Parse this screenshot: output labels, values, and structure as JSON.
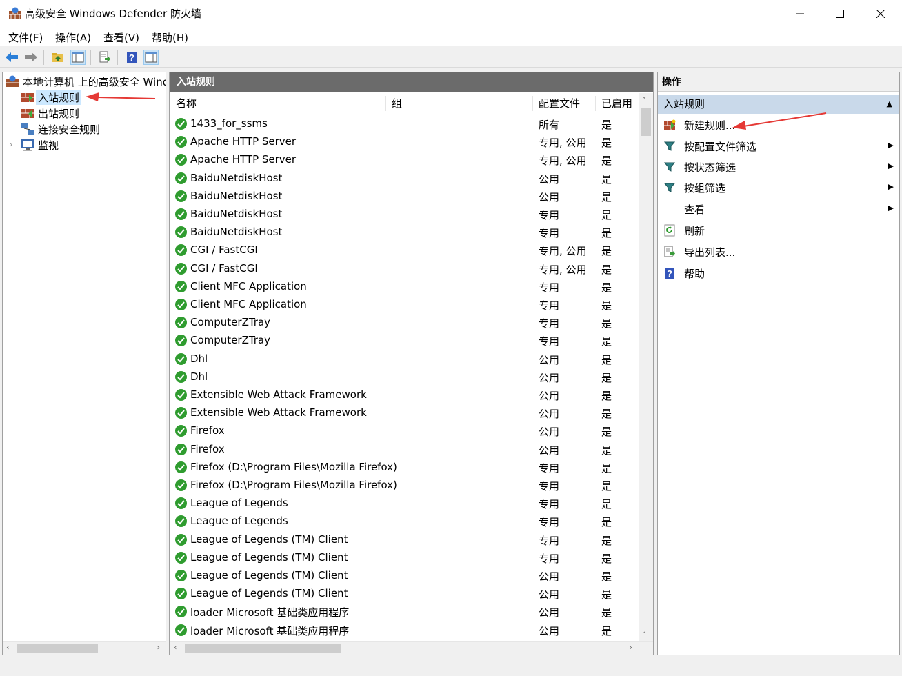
{
  "window": {
    "title": "高级安全 Windows Defender 防火墙",
    "controls": [
      "minimize",
      "maximize",
      "close"
    ]
  },
  "menu": [
    "文件(F)",
    "操作(A)",
    "查看(V)",
    "帮助(H)"
  ],
  "toolbar": [
    "back-icon",
    "forward-icon",
    "up-folder-icon",
    "show-tree-icon",
    "export-icon",
    "help-icon",
    "show-action-pane-icon"
  ],
  "tree": {
    "root": "本地计算机 上的高级安全 Windows Defender 防火墙",
    "items": [
      {
        "label": "入站规则",
        "selected": true
      },
      {
        "label": "出站规则"
      },
      {
        "label": "连接安全规则"
      },
      {
        "label": "监视",
        "expandable": true
      }
    ]
  },
  "middle": {
    "header": "入站规则",
    "columns": [
      "名称",
      "组",
      "配置文件",
      "已启用"
    ],
    "rows": [
      {
        "name": "1433_for_ssms",
        "group": "",
        "profile": "所有",
        "enabled": "是"
      },
      {
        "name": "Apache HTTP Server",
        "group": "",
        "profile": "专用, 公用",
        "enabled": "是"
      },
      {
        "name": "Apache HTTP Server",
        "group": "",
        "profile": "专用, 公用",
        "enabled": "是"
      },
      {
        "name": "BaiduNetdiskHost",
        "group": "",
        "profile": "公用",
        "enabled": "是"
      },
      {
        "name": "BaiduNetdiskHost",
        "group": "",
        "profile": "公用",
        "enabled": "是"
      },
      {
        "name": "BaiduNetdiskHost",
        "group": "",
        "profile": "专用",
        "enabled": "是"
      },
      {
        "name": "BaiduNetdiskHost",
        "group": "",
        "profile": "专用",
        "enabled": "是"
      },
      {
        "name": "CGI / FastCGI",
        "group": "",
        "profile": "专用, 公用",
        "enabled": "是"
      },
      {
        "name": "CGI / FastCGI",
        "group": "",
        "profile": "专用, 公用",
        "enabled": "是"
      },
      {
        "name": "Client MFC Application",
        "group": "",
        "profile": "专用",
        "enabled": "是"
      },
      {
        "name": "Client MFC Application",
        "group": "",
        "profile": "专用",
        "enabled": "是"
      },
      {
        "name": "ComputerZTray",
        "group": "",
        "profile": "专用",
        "enabled": "是"
      },
      {
        "name": "ComputerZTray",
        "group": "",
        "profile": "专用",
        "enabled": "是"
      },
      {
        "name": "Dhl",
        "group": "",
        "profile": "公用",
        "enabled": "是"
      },
      {
        "name": "Dhl",
        "group": "",
        "profile": "公用",
        "enabled": "是"
      },
      {
        "name": "Extensible Web Attack Framework",
        "group": "",
        "profile": "公用",
        "enabled": "是"
      },
      {
        "name": "Extensible Web Attack Framework",
        "group": "",
        "profile": "公用",
        "enabled": "是"
      },
      {
        "name": "Firefox",
        "group": "",
        "profile": "公用",
        "enabled": "是"
      },
      {
        "name": "Firefox",
        "group": "",
        "profile": "公用",
        "enabled": "是"
      },
      {
        "name": "Firefox (D:\\Program Files\\Mozilla Firefox)",
        "group": "",
        "profile": "专用",
        "enabled": "是"
      },
      {
        "name": "Firefox (D:\\Program Files\\Mozilla Firefox)",
        "group": "",
        "profile": "专用",
        "enabled": "是"
      },
      {
        "name": "League of Legends",
        "group": "",
        "profile": "专用",
        "enabled": "是"
      },
      {
        "name": "League of Legends",
        "group": "",
        "profile": "专用",
        "enabled": "是"
      },
      {
        "name": "League of Legends (TM) Client",
        "group": "",
        "profile": "专用",
        "enabled": "是"
      },
      {
        "name": "League of Legends (TM) Client",
        "group": "",
        "profile": "专用",
        "enabled": "是"
      },
      {
        "name": "League of Legends (TM) Client",
        "group": "",
        "profile": "公用",
        "enabled": "是"
      },
      {
        "name": "League of Legends (TM) Client",
        "group": "",
        "profile": "公用",
        "enabled": "是"
      },
      {
        "name": "loader Microsoft 基础类应用程序",
        "group": "",
        "profile": "公用",
        "enabled": "是"
      },
      {
        "name": "loader Microsoft 基础类应用程序",
        "group": "",
        "profile": "公用",
        "enabled": "是"
      }
    ]
  },
  "actions": {
    "header": "操作",
    "section": "入站规则",
    "items": [
      {
        "label": "新建规则...",
        "icon": "new-rule-icon"
      },
      {
        "label": "按配置文件筛选",
        "icon": "filter-icon",
        "submenu": true
      },
      {
        "label": "按状态筛选",
        "icon": "filter-icon",
        "submenu": true
      },
      {
        "label": "按组筛选",
        "icon": "filter-icon",
        "submenu": true
      },
      {
        "label": "查看",
        "icon": "",
        "submenu": true
      },
      {
        "label": "刷新",
        "icon": "refresh-icon"
      },
      {
        "label": "导出列表...",
        "icon": "export-list-icon"
      },
      {
        "label": "帮助",
        "icon": "help-icon"
      }
    ]
  },
  "colors": {
    "accent_arrow": "#e53935",
    "enabled_icon": "#2f9c2f",
    "section_header": "#6b6b6b",
    "action_sub": "#c9d9ea"
  }
}
